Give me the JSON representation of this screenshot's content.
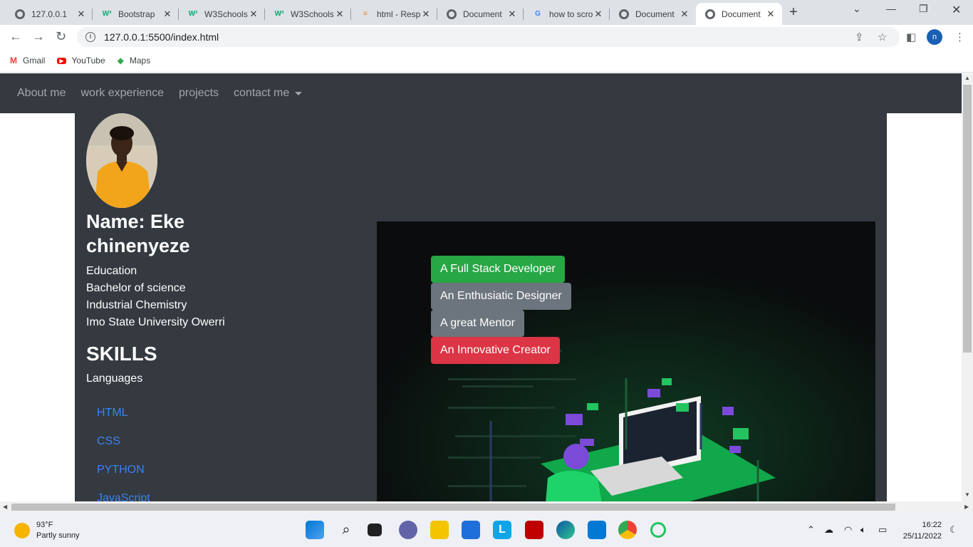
{
  "browser": {
    "tabs": [
      {
        "title": "127.0.0.1",
        "favicon": "globe-icon"
      },
      {
        "title": "Bootstrap",
        "favicon": "w3schools-icon"
      },
      {
        "title": "W3Schools",
        "favicon": "w3schools-icon"
      },
      {
        "title": "W3Schools",
        "favicon": "w3schools-icon"
      },
      {
        "title": "html - Resp",
        "favicon": "stackoverflow-icon"
      },
      {
        "title": "Document",
        "favicon": "globe-icon"
      },
      {
        "title": "how to scro",
        "favicon": "google-icon"
      },
      {
        "title": "Document",
        "favicon": "globe-icon"
      },
      {
        "title": "Document",
        "favicon": "globe-icon"
      }
    ],
    "active_tab_index": 8,
    "url": "127.0.0.1:5500/index.html",
    "profile_initial": "n",
    "bookmarks": [
      {
        "label": "Gmail",
        "icon": "gmail-icon"
      },
      {
        "label": "YouTube",
        "icon": "youtube-icon"
      },
      {
        "label": "Maps",
        "icon": "maps-icon"
      }
    ]
  },
  "page": {
    "nav": {
      "items": [
        "About me",
        "work experience",
        "projects",
        "contact me"
      ]
    },
    "profile": {
      "name": "Name: Eke chinenyeze",
      "education": [
        "Education",
        "Bachelor of science",
        "Industrial Chemistry",
        "Imo State University Owerri"
      ],
      "skills_heading": "SKILLS",
      "languages_label": "Languages",
      "skills": [
        "HTML",
        "CSS",
        "PYTHON",
        "JavaScript"
      ]
    },
    "hero": {
      "buttons": [
        {
          "label": "A Full Stack Developer",
          "color": "#28a745"
        },
        {
          "label": "An Enthusiatic Designer",
          "color": "#6c757d"
        },
        {
          "label": "A great Mentor",
          "color": "#6c757d"
        },
        {
          "label": "An Innovative Creator",
          "color": "#dc3545"
        }
      ]
    }
  },
  "taskbar": {
    "weather_temp": "93°F",
    "weather_desc": "Partly sunny",
    "time": "16:22",
    "date": "25/11/2022"
  },
  "colors": {
    "navbar": "#343a40",
    "link": "#3b82f6",
    "hero_bg": "#0a0c0d"
  }
}
